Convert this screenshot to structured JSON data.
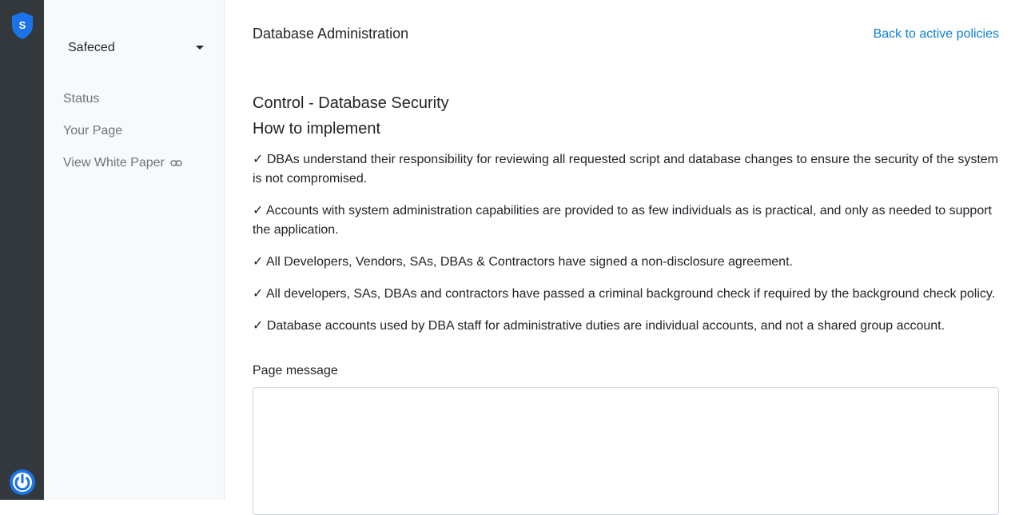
{
  "rail": {
    "logo_letter": "S",
    "brand_color": "#1a73e8"
  },
  "sidebar": {
    "org_name": "Safeced",
    "items": [
      {
        "label": "Status"
      },
      {
        "label": "Your Page"
      },
      {
        "label": "View White Paper",
        "icon": "link-icon"
      }
    ]
  },
  "header": {
    "title": "Database Administration",
    "back_link": "Back to active policies"
  },
  "content": {
    "control_title": "Control - Database Security",
    "implement_title": "How to implement",
    "checklist": [
      "✓ DBAs understand their responsibility for reviewing all requested script and database changes to ensure the security of the system is not compromised.",
      "✓ Accounts with system administration capabilities are provided to as few individuals as is practical, and only as needed to support the application.",
      "✓ All Developers, Vendors, SAs, DBAs & Contractors have signed a non-disclosure agreement.",
      "✓ All developers, SAs, DBAs and contractors have passed a criminal background check if required by the background check policy.",
      "✓ Database accounts used by DBA staff for administrative duties are individual accounts, and not a shared group account."
    ],
    "message_label": "Page message",
    "message_value": ""
  },
  "colors": {
    "rail_bg": "#33383d",
    "sidebar_bg": "#f8f9fa",
    "link": "#0d7fd4"
  }
}
